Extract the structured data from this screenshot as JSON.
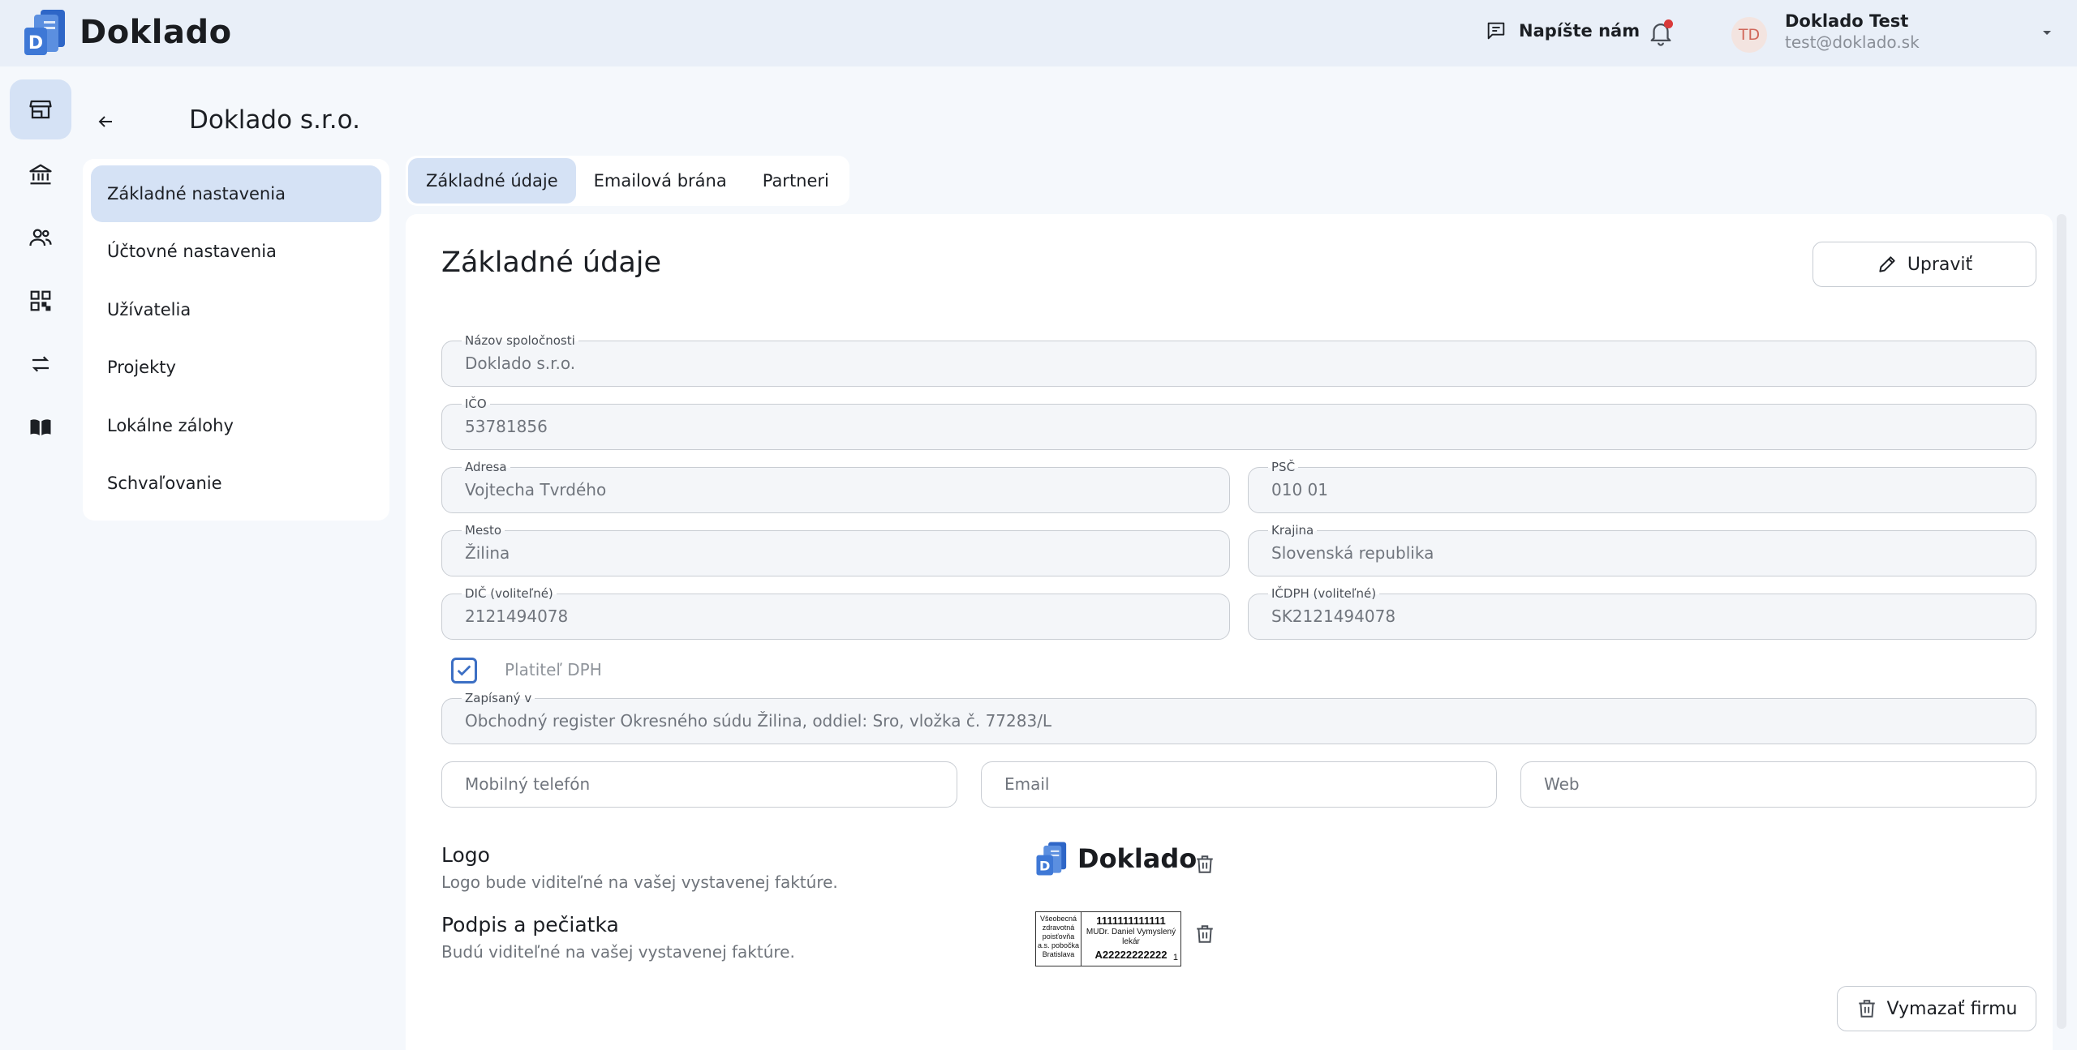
{
  "app": {
    "brand": "Doklado"
  },
  "header": {
    "contact_label": "Napíšte nám",
    "user": {
      "initials": "TD",
      "name": "Doklado Test",
      "email": "test@doklado.sk"
    }
  },
  "rail": {
    "icons": [
      "store-icon",
      "bank-icon",
      "users-icon",
      "qr-code-icon",
      "transfer-icon",
      "book-icon"
    ]
  },
  "page": {
    "title": "Doklado s.r.o."
  },
  "menu": {
    "items": [
      "Základné nastavenia",
      "Účtovné nastavenia",
      "Užívatelia",
      "Projekty",
      "Lokálne zálohy",
      "Schvaľovanie"
    ]
  },
  "tabs": [
    "Základné údaje",
    "Emailová brána",
    "Partneri"
  ],
  "form": {
    "section_title": "Základné údaje",
    "edit_label": "Upraviť",
    "company_name": {
      "label": "Názov spoločnosti",
      "value": "Doklado s.r.o."
    },
    "ico": {
      "label": "IČO",
      "value": "53781856"
    },
    "address": {
      "label": "Adresa",
      "value": "Vojtecha Tvrdého"
    },
    "zip": {
      "label": "PSČ",
      "value": "010 01"
    },
    "city": {
      "label": "Mesto",
      "value": "Žilina"
    },
    "country": {
      "label": "Krajina",
      "value": "Slovenská republika"
    },
    "dic": {
      "label": "DIČ (voliteľné)",
      "value": "2121494078"
    },
    "icdph": {
      "label": "IČDPH (voliteľné)",
      "value": "SK2121494078"
    },
    "vat_payer": {
      "label": "Platiteľ DPH",
      "checked": true
    },
    "registered": {
      "label": "Zapísaný v",
      "value": "Obchodný register Okresného súdu Žilina, oddiel: Sro, vložka č. 77283/L"
    },
    "phone_placeholder": "Mobilný telefón",
    "email_placeholder": "Email",
    "web_placeholder": "Web",
    "logo": {
      "title": "Logo",
      "desc": "Logo bude viditeľné na vašej vystavenej faktúre.",
      "preview_text": "Doklado"
    },
    "signature": {
      "title": "Podpis a pečiatka",
      "desc": "Budú viditeľné na vašej vystavenej faktúre.",
      "stamp_left": "Všeobecná zdravotná poisťovňa a.s. pobočka Bratislava",
      "stamp_number": "1111111111111",
      "stamp_doctor": "MUDr. Daniel Vymyslený lekár",
      "stamp_code": "A22222222222",
      "stamp_one": "1"
    },
    "delete_label": "Vymazať firmu"
  },
  "colors": {
    "accent": "#d5e2f5",
    "primary": "#3c6fc4",
    "topbar": "#e9eff8",
    "notification": "#d93a3a"
  }
}
